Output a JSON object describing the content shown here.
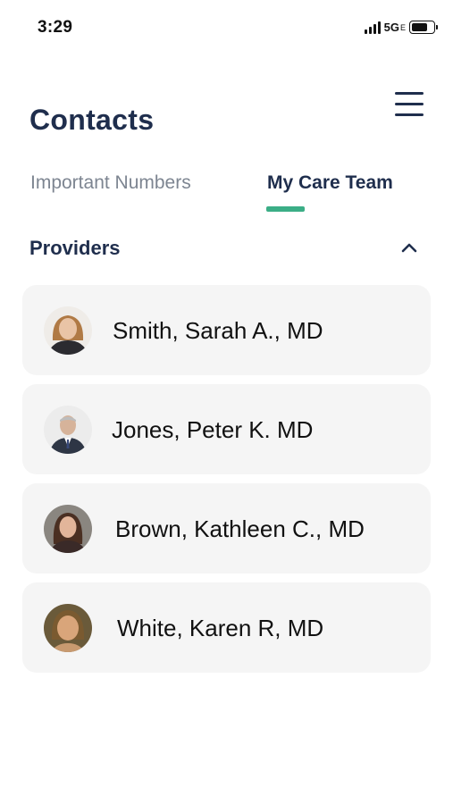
{
  "status_bar": {
    "time": "3:29",
    "network": "5G",
    "network_suffix": "E",
    "icons": [
      "signal-icon",
      "battery-icon"
    ]
  },
  "header": {
    "title": "Contacts",
    "menu_icon": "hamburger-menu-icon"
  },
  "tabs": [
    {
      "label": "Important Numbers",
      "active": false
    },
    {
      "label": "My Care Team",
      "active": true
    }
  ],
  "section": {
    "title": "Providers",
    "toggle_icon": "chevron-up-icon",
    "expanded": true
  },
  "providers": [
    {
      "name": "Smith, Sarah A., MD"
    },
    {
      "name": "Jones, Peter K. MD"
    },
    {
      "name": "Brown, Kathleen C., MD"
    },
    {
      "name": "White, Karen R, MD"
    }
  ],
  "colors": {
    "primary_text": "#1f2e4d",
    "inactive_tab": "#7d8591",
    "accent": "#3bae86",
    "card_background": "#f5f5f5"
  }
}
